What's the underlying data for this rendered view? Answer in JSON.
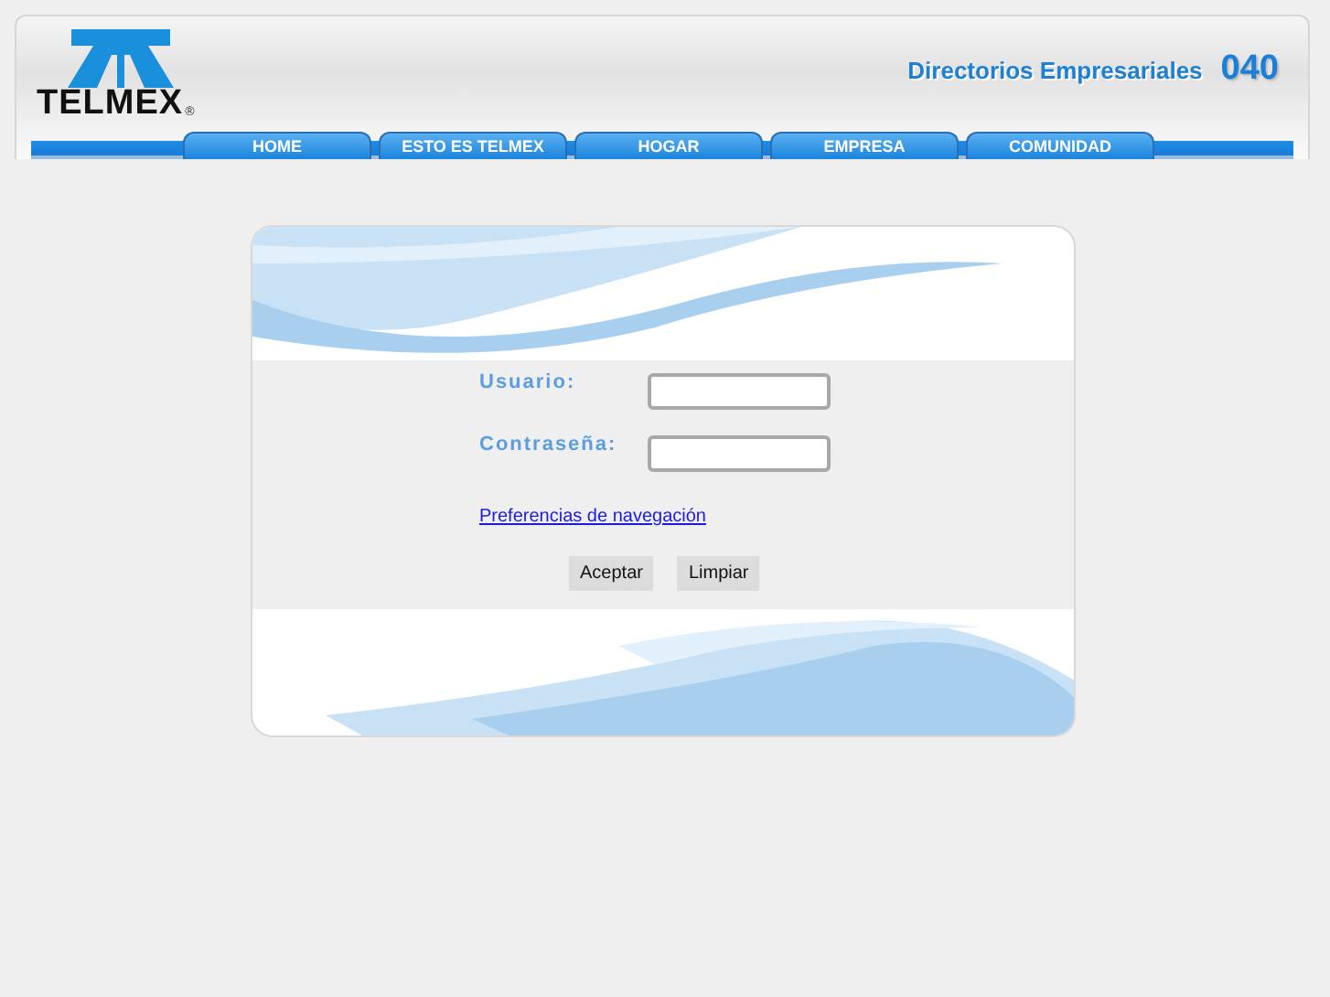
{
  "header": {
    "logo_text": "TELMEX",
    "logo_mark": "®",
    "title": "Directorios Empresariales",
    "number": "040"
  },
  "nav": [
    {
      "label": "HOME"
    },
    {
      "label": "ESTO ES TELMEX"
    },
    {
      "label": "HOGAR"
    },
    {
      "label": "EMPRESA"
    },
    {
      "label": "COMUNIDAD"
    }
  ],
  "login": {
    "fields": [
      {
        "label": "Usuario:"
      },
      {
        "label": "Contraseña:"
      }
    ],
    "link": "Preferencias de navegación",
    "buttons": [
      "Aceptar",
      "Limpiar"
    ]
  }
}
